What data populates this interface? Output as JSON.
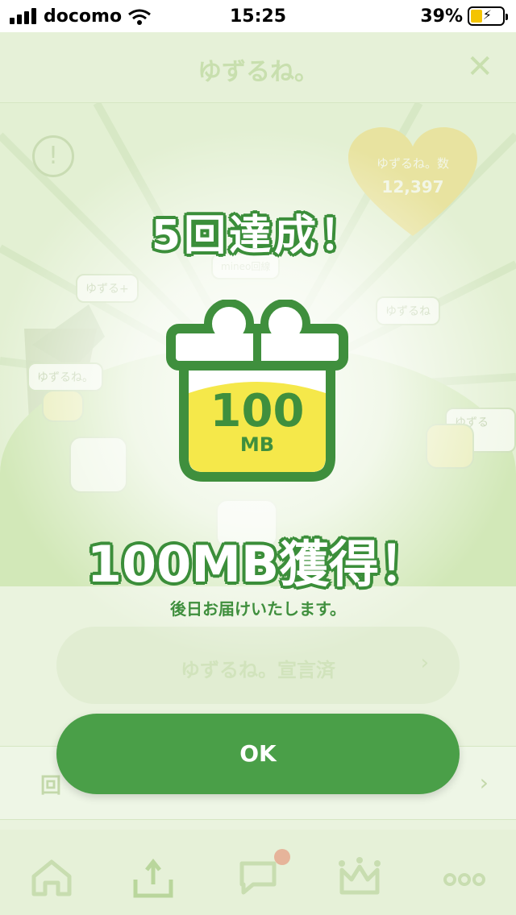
{
  "status_bar": {
    "carrier": "docomo",
    "time": "15:25",
    "battery": "39%",
    "battery_level": 0.39,
    "icons": [
      "signal-icon",
      "wifi-icon",
      "battery-charging-icon"
    ]
  },
  "header": {
    "title": "ゆずるね。",
    "close_icon": "close-icon"
  },
  "background": {
    "heart_label": "ゆずるね。数",
    "heart_count": "12,397",
    "bubbles": [
      "ゆずる+",
      "ゆずるね",
      "ゆずるね。",
      "ゆずるね。"
    ],
    "sign_text": "mineo回線",
    "declare_button": "ゆずるね。宣言済",
    "row_label": "回"
  },
  "modal": {
    "achievement": "5回達成！",
    "gift_amount": "100",
    "gift_unit": "MB",
    "gained": "100MB獲得！",
    "note": "後日お届けいたします。",
    "ok_label": "OK"
  },
  "tab_bar": {
    "tabs": [
      "home-icon",
      "upload-tray-icon",
      "chat-icon",
      "crown-icon",
      "more-icon"
    ]
  },
  "colors": {
    "accent_green": "#4a9f48",
    "outline_green": "#3b8e3a",
    "gift_yellow": "#f5e84a",
    "notification_dot": "#e6b49a"
  }
}
